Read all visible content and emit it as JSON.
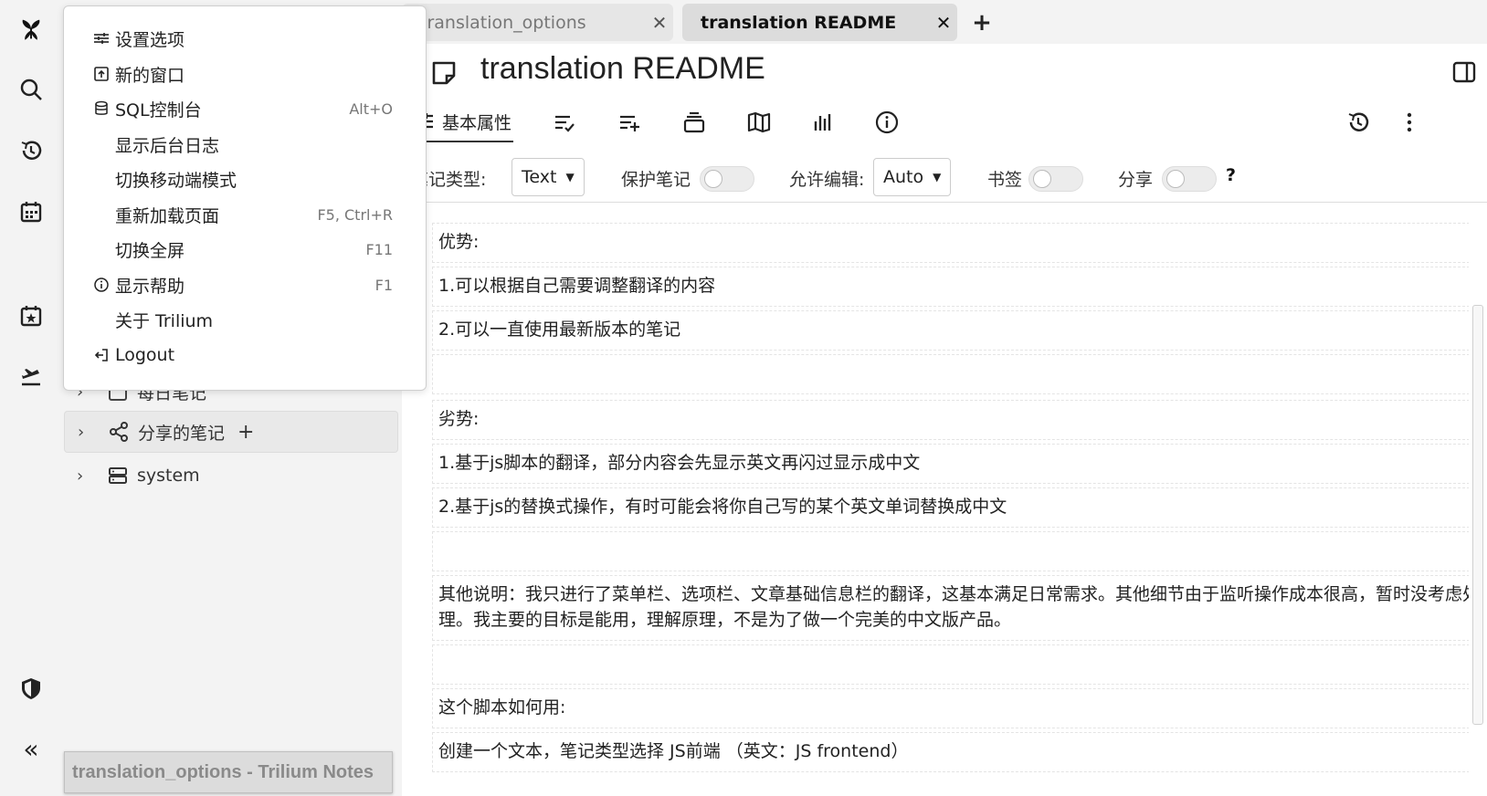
{
  "tabs": [
    {
      "title": "translation_options",
      "active": false,
      "close": "✕"
    },
    {
      "title": "translation README",
      "active": true,
      "close": "✕"
    }
  ],
  "new_tab_label": "+",
  "note": {
    "title": "translation README"
  },
  "ribbon": {
    "basic_label": "基本属性"
  },
  "props": {
    "note_type_label": "笔记类型:",
    "note_type_value": "Text",
    "protect_label": "保护笔记",
    "edit_label": "允许编辑:",
    "edit_value": "Auto",
    "bookmark_label": "书签",
    "share_label": "分享",
    "help": "?"
  },
  "tree": {
    "items": [
      {
        "label": "每日笔记"
      },
      {
        "label": "分享的笔记",
        "plus": "+"
      },
      {
        "label": "system"
      }
    ]
  },
  "tooltip": "translation_options - Trilium Notes",
  "menu": {
    "items": [
      {
        "label": "设置选项",
        "shortcut": ""
      },
      {
        "label": "新的窗口",
        "shortcut": ""
      },
      {
        "label": "SQL控制台",
        "shortcut": "Alt+O"
      },
      {
        "label": "显示后台日志",
        "shortcut": ""
      },
      {
        "label": "切换移动端模式",
        "shortcut": ""
      },
      {
        "label": "重新加载页面",
        "shortcut": "F5, Ctrl+R"
      },
      {
        "label": "切换全屏",
        "shortcut": "F11"
      },
      {
        "label": "显示帮助",
        "shortcut": "F1"
      },
      {
        "label": "关于 Trilium",
        "shortcut": ""
      },
      {
        "label": "Logout",
        "shortcut": ""
      }
    ]
  },
  "content": {
    "blocks": [
      "优势:",
      "1.可以根据自己需要调整翻译的内容",
      "2.可以一直使用最新版本的笔记",
      "",
      "劣势:",
      "1.基于js脚本的翻译，部分内容会先显示英文再闪过显示成中文",
      "2.基于js的替换式操作，有时可能会将你自己写的某个英文单词替换成中文",
      "",
      "其他说明：我只进行了菜单栏、选项栏、文章基础信息栏的翻译，这基本满足日常需求。其他细节由于监听操作成本很高，暂时没考虑处理。我主要的目标是能用，理解原理，不是为了做一个完美的中文版产品。",
      "",
      "这个脚本如何用:",
      "创建一个文本，笔记类型选择 JS前端 （英文：JS frontend）"
    ]
  },
  "launcher": {
    "collapse_label": "«"
  }
}
